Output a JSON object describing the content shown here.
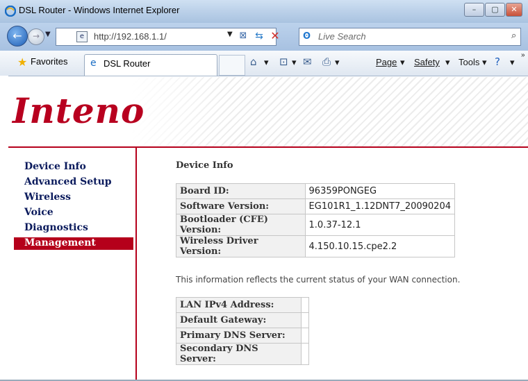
{
  "window": {
    "title": "DSL Router - Windows Internet Explorer",
    "buttons": [
      "–",
      "▢",
      "✕"
    ]
  },
  "address": {
    "url": "http://192.168.1.1/",
    "search_placeholder": "Live Search"
  },
  "favorites": {
    "label": "Favorites",
    "tab_label": "DSL Router"
  },
  "commands": {
    "page": "Page",
    "safety": "Safety",
    "tools": "Tools"
  },
  "brand": {
    "logo": "Inteno",
    "color": "#b5001b"
  },
  "sidebar": {
    "items": [
      {
        "label": "Device Info"
      },
      {
        "label": "Advanced Setup"
      },
      {
        "label": "Wireless"
      },
      {
        "label": "Voice"
      },
      {
        "label": "Diagnostics"
      },
      {
        "label": "Management",
        "active": true
      }
    ]
  },
  "main": {
    "heading": "Device Info",
    "device_table": [
      {
        "key": "Board ID:",
        "value": "96359PONGEG"
      },
      {
        "key": "Software Version:",
        "value": "EG101R1_1.12DNT7_20090204"
      },
      {
        "key": "Bootloader (CFE) Version:",
        "value": "1.0.37-12.1"
      },
      {
        "key": "Wireless Driver Version:",
        "value": "4.150.10.15.cpe2.2"
      }
    ],
    "wan_note": "This information reflects the current status of your WAN connection.",
    "wan_table": [
      {
        "key": "LAN IPv4 Address:",
        "value": ""
      },
      {
        "key": "Default Gateway:",
        "value": ""
      },
      {
        "key": "Primary DNS Server:",
        "value": ""
      },
      {
        "key": "Secondary DNS Server:",
        "value": ""
      }
    ]
  }
}
